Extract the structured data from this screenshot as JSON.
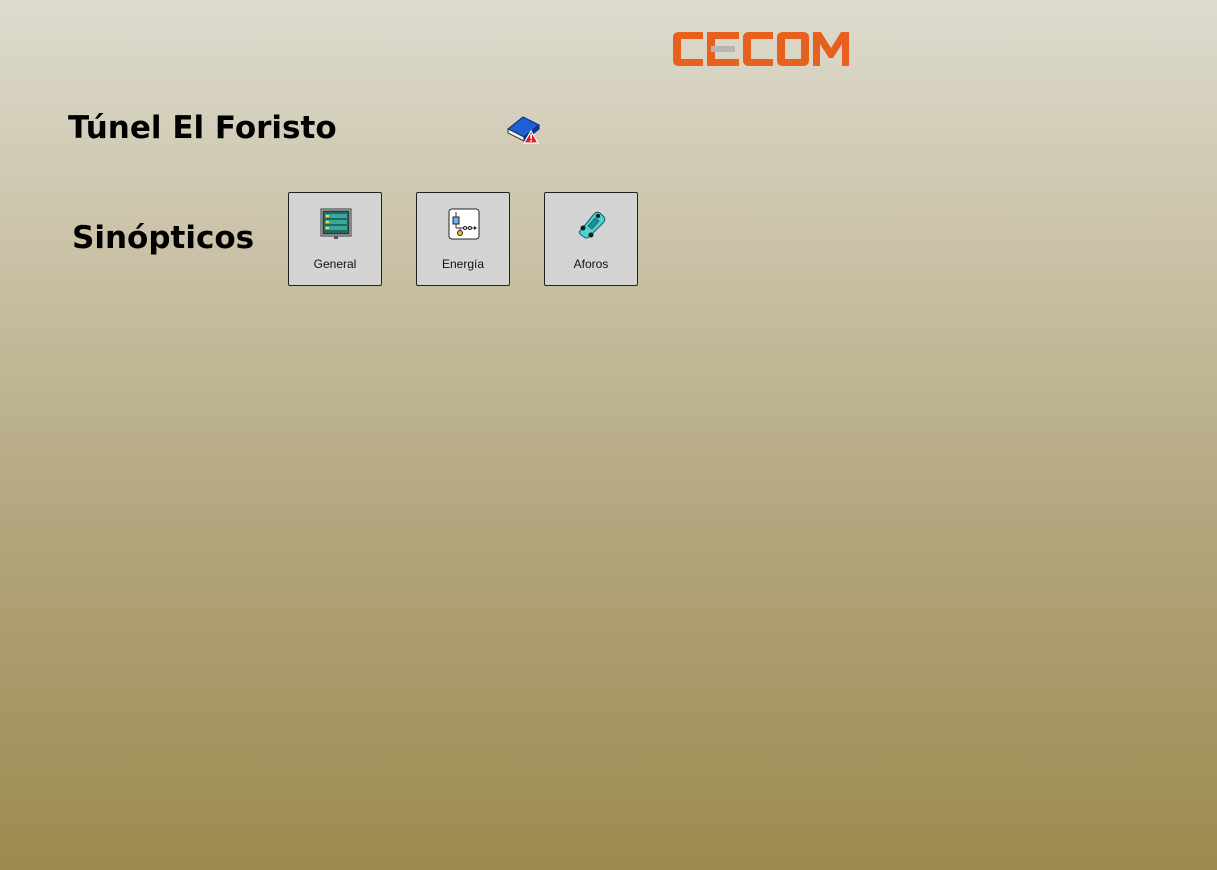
{
  "brand": {
    "logo_text": "CECOM",
    "logo_color": "#e8601e",
    "logo_bar_color": "#b5b5b5"
  },
  "header": {
    "title": "Túnel El Foristo",
    "alarm_icon": "book-alarm-icon"
  },
  "synoptics": {
    "section_label": "Sinópticos",
    "buttons": [
      {
        "label": "General",
        "icon": "monitor-panel-icon"
      },
      {
        "label": "Energía",
        "icon": "electrical-diagram-icon"
      },
      {
        "label": "Aforos",
        "icon": "car-icon"
      }
    ]
  }
}
